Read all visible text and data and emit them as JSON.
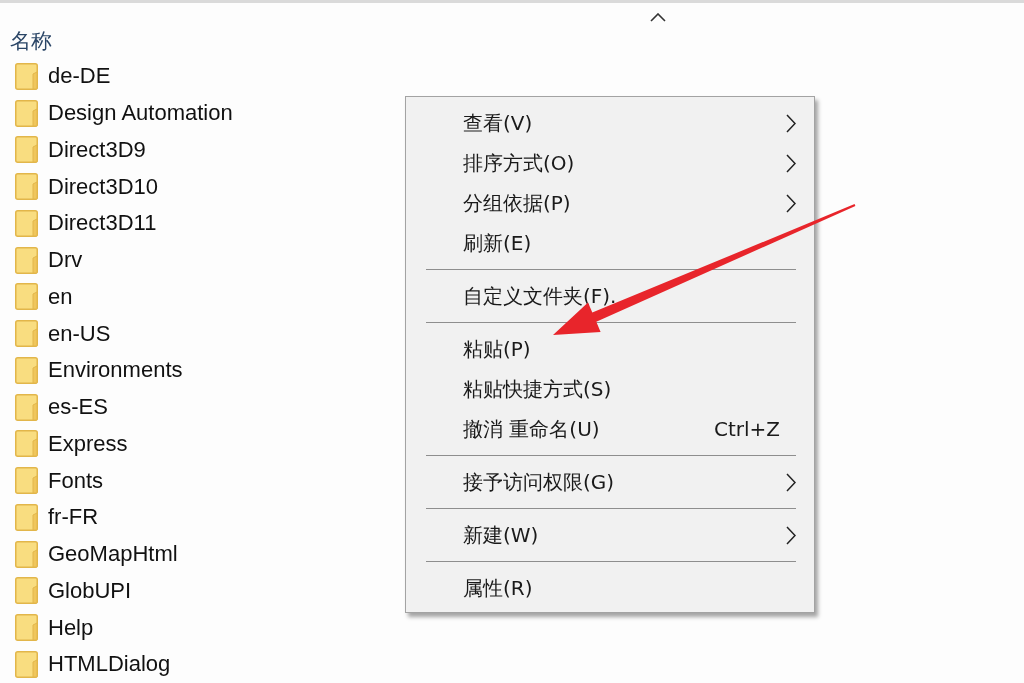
{
  "file_list": {
    "column_header": "名称",
    "folders": [
      "de-DE",
      "Design Automation",
      "Direct3D9",
      "Direct3D10",
      "Direct3D11",
      "Drv",
      "en",
      "en-US",
      "Environments",
      "es-ES",
      "Express",
      "Fonts",
      "fr-FR",
      "GeoMapHtml",
      "GlobUPI",
      "Help",
      "HTMLDialog"
    ]
  },
  "context_menu": {
    "groups": [
      {
        "items": [
          {
            "label": "查看(V)",
            "submenu": true
          },
          {
            "label": "排序方式(O)",
            "submenu": true
          },
          {
            "label": "分组依据(P)",
            "submenu": true
          },
          {
            "label": "刷新(E)",
            "submenu": false
          }
        ]
      },
      {
        "items": [
          {
            "label": "自定义文件夹(F).",
            "submenu": false
          }
        ]
      },
      {
        "items": [
          {
            "label": "粘贴(P)",
            "submenu": false
          },
          {
            "label": "粘贴快捷方式(S)",
            "submenu": false
          },
          {
            "label": "撤消 重命名(U)",
            "shortcut": "Ctrl+Z",
            "submenu": false
          }
        ]
      },
      {
        "items": [
          {
            "label": "接予访问权限(G)",
            "submenu": true
          }
        ]
      },
      {
        "items": [
          {
            "label": "新建(W)",
            "submenu": true
          }
        ]
      },
      {
        "items": [
          {
            "label": "属性(R)",
            "submenu": false
          }
        ]
      }
    ]
  }
}
